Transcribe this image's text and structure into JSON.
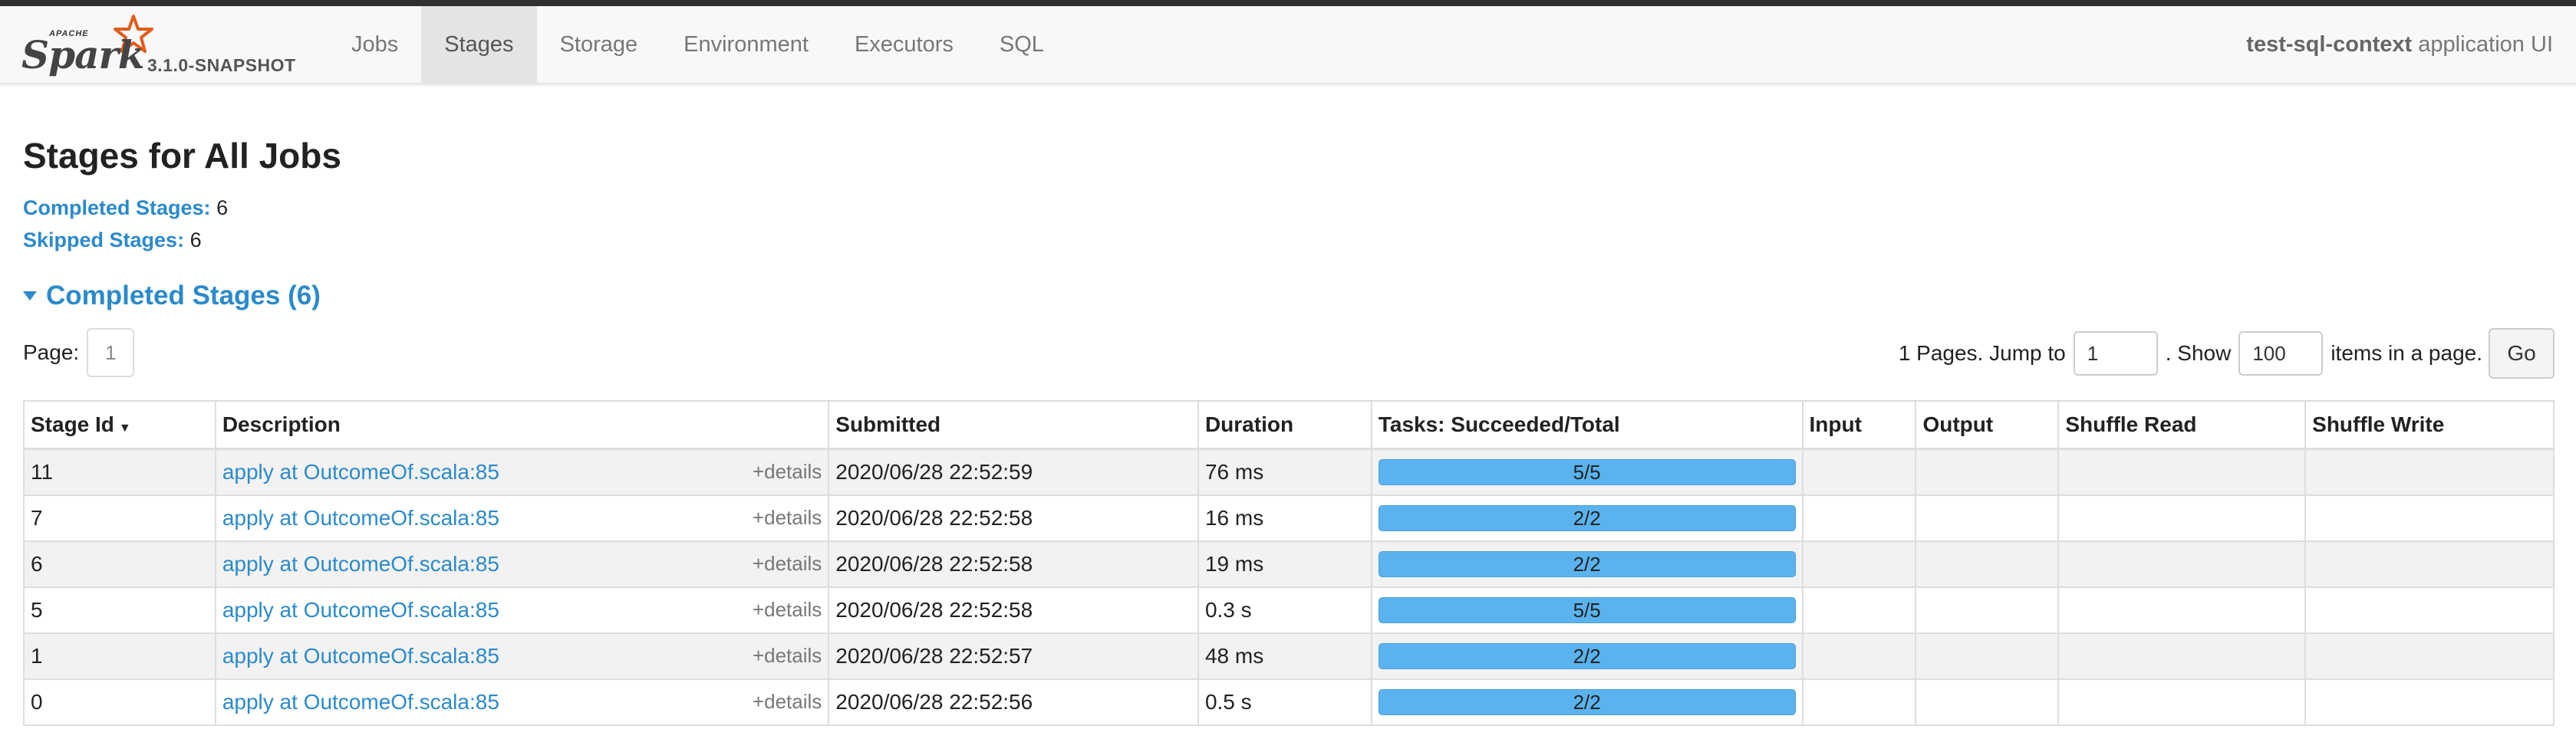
{
  "brand": {
    "apache": "APACHE",
    "spark": "Spark",
    "version": "3.1.0-SNAPSHOT"
  },
  "nav": {
    "items": [
      {
        "label": "Jobs"
      },
      {
        "label": "Stages"
      },
      {
        "label": "Storage"
      },
      {
        "label": "Environment"
      },
      {
        "label": "Executors"
      },
      {
        "label": "SQL"
      }
    ],
    "active": "Stages",
    "app_name": "test-sql-context",
    "app_suffix": "application UI"
  },
  "page": {
    "title": "Stages for All Jobs",
    "completed_label": "Completed Stages:",
    "completed_value": "6",
    "skipped_label": "Skipped Stages:",
    "skipped_value": "6",
    "section_title": "Completed Stages (6)"
  },
  "pager": {
    "page_label": "Page:",
    "current_page": "1",
    "pages_text": "1 Pages. Jump to",
    "jump_value": "1",
    "show_text": ". Show",
    "show_value": "100",
    "items_text": "items in a page.",
    "go_label": "Go"
  },
  "table": {
    "columns": [
      "Stage Id",
      "Description",
      "Submitted",
      "Duration",
      "Tasks: Succeeded/Total",
      "Input",
      "Output",
      "Shuffle Read",
      "Shuffle Write"
    ],
    "sort_indicator": "▼",
    "details_label": "+details",
    "rows": [
      {
        "id": "11",
        "desc": "apply at OutcomeOf.scala:85",
        "submitted": "2020/06/28 22:52:59",
        "duration": "76 ms",
        "tasks": "5/5",
        "tasks_fraction": 1.0,
        "input": "",
        "output": "",
        "shuffle_read": "",
        "shuffle_write": ""
      },
      {
        "id": "7",
        "desc": "apply at OutcomeOf.scala:85",
        "submitted": "2020/06/28 22:52:58",
        "duration": "16 ms",
        "tasks": "2/2",
        "tasks_fraction": 1.0,
        "input": "",
        "output": "",
        "shuffle_read": "",
        "shuffle_write": ""
      },
      {
        "id": "6",
        "desc": "apply at OutcomeOf.scala:85",
        "submitted": "2020/06/28 22:52:58",
        "duration": "19 ms",
        "tasks": "2/2",
        "tasks_fraction": 1.0,
        "input": "",
        "output": "",
        "shuffle_read": "",
        "shuffle_write": ""
      },
      {
        "id": "5",
        "desc": "apply at OutcomeOf.scala:85",
        "submitted": "2020/06/28 22:52:58",
        "duration": "0.3 s",
        "tasks": "5/5",
        "tasks_fraction": 1.0,
        "input": "",
        "output": "",
        "shuffle_read": "",
        "shuffle_write": ""
      },
      {
        "id": "1",
        "desc": "apply at OutcomeOf.scala:85",
        "submitted": "2020/06/28 22:52:57",
        "duration": "48 ms",
        "tasks": "2/2",
        "tasks_fraction": 1.0,
        "input": "",
        "output": "",
        "shuffle_read": "",
        "shuffle_write": ""
      },
      {
        "id": "0",
        "desc": "apply at OutcomeOf.scala:85",
        "submitted": "2020/06/28 22:52:56",
        "duration": "0.5 s",
        "tasks": "2/2",
        "tasks_fraction": 1.0,
        "input": "",
        "output": "",
        "shuffle_read": "",
        "shuffle_write": ""
      }
    ]
  },
  "colors": {
    "link": "#2b8acb",
    "progress_fill": "#5ab3ee",
    "top_bar": "#2f2f2f",
    "star": "#e25a1c"
  },
  "icons": {
    "logo_star": "star-icon",
    "collapse": "triangle-down-icon",
    "sort": "sort-desc-icon"
  }
}
